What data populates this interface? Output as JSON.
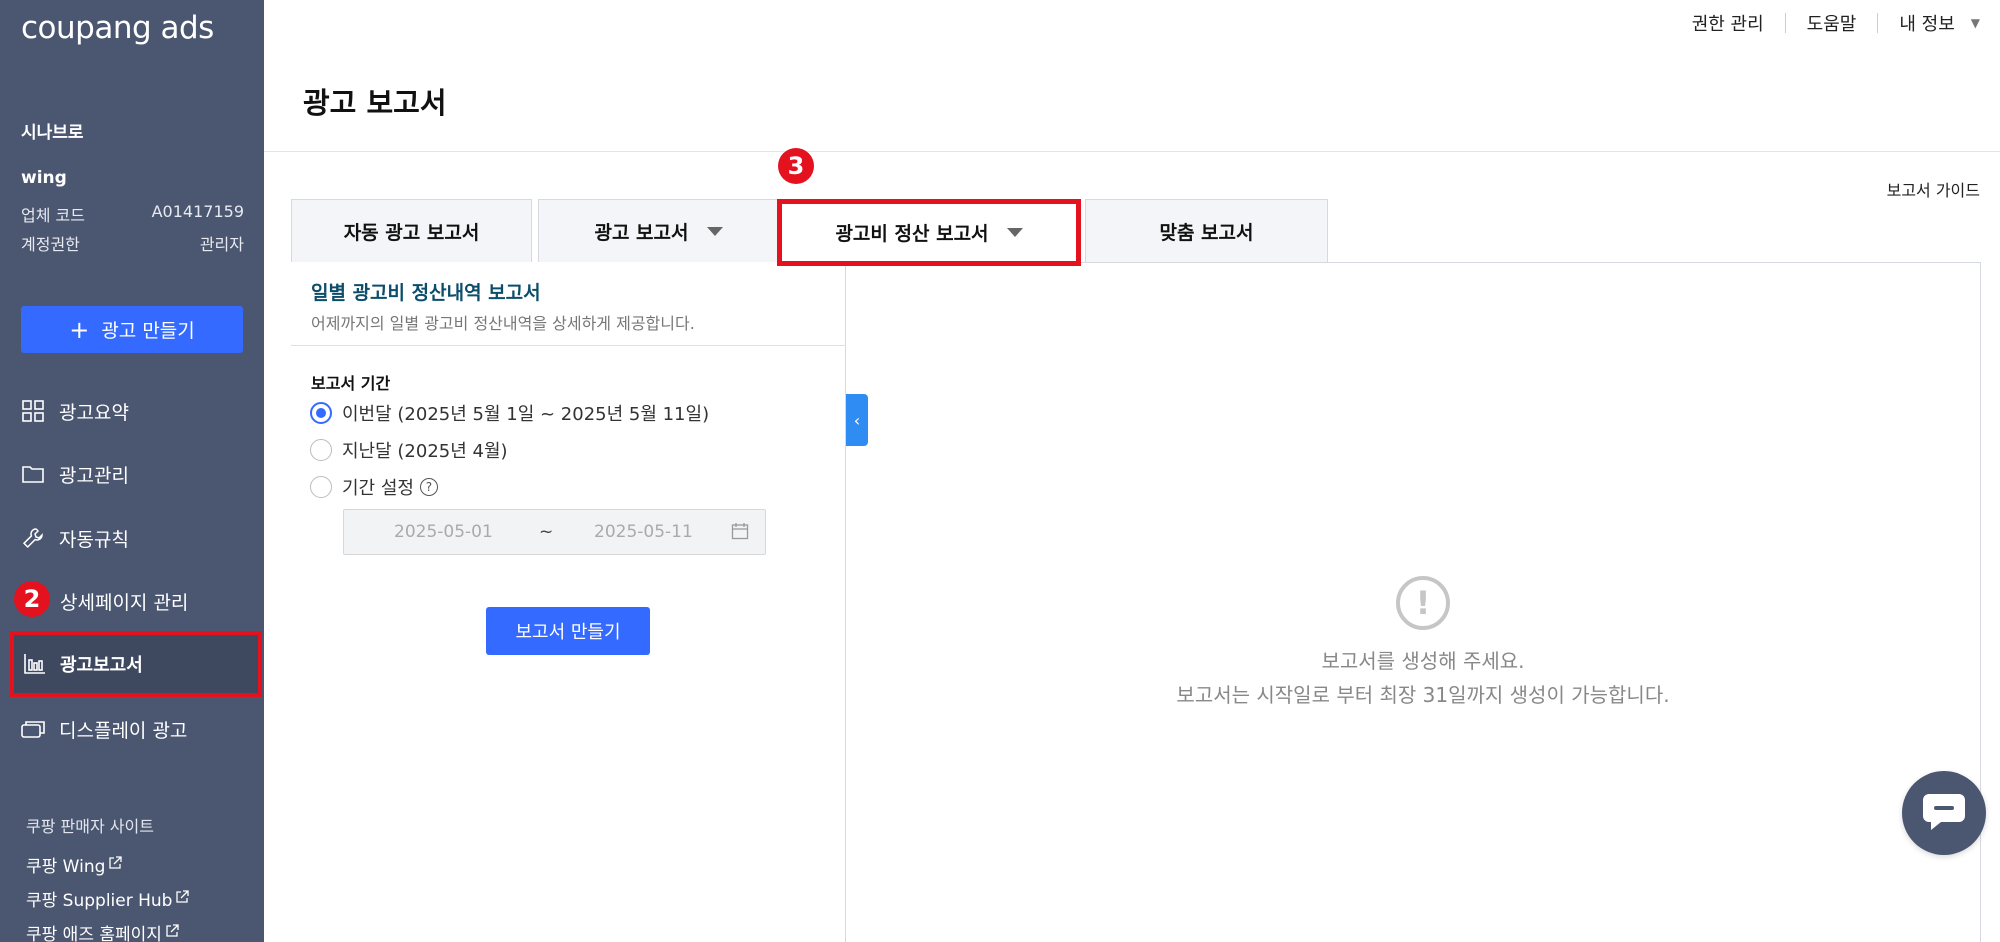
{
  "sidebar": {
    "logo": "coupang ads",
    "company_name": "시나브로",
    "account_id": "wing",
    "vendor_code_label": "업체 코드",
    "vendor_code_value": "A01417159",
    "permission_label": "계정권한",
    "permission_value": "관리자",
    "create_ad_label": "광고 만들기",
    "nav": {
      "summary": "광고요약",
      "management": "광고관리",
      "auto_rules": "자동규칙",
      "detail_page": "상세페이지 관리",
      "reports": "광고보고서",
      "display": "디스플레이 광고"
    },
    "seller_sites_title": "쿠팡 판매자 사이트",
    "seller_links": [
      "쿠팡 Wing",
      "쿠팡 Supplier Hub",
      "쿠팡 애즈 홈페이지"
    ]
  },
  "annotations": {
    "badge_2": "2",
    "badge_3": "3"
  },
  "header": {
    "permission_mgmt": "권한 관리",
    "help": "도움말",
    "my_info": "내 정보"
  },
  "page": {
    "title": "광고 보고서",
    "guide_link": "보고서 가이드"
  },
  "tabs": [
    {
      "label": "자동 광고 보고서"
    },
    {
      "label": "광고 보고서"
    },
    {
      "label": "광고비 정산 보고서"
    },
    {
      "label": "맞춤 보고서"
    }
  ],
  "left_panel": {
    "title": "일별 광고비 정산내역 보고서",
    "description": "어제까지의 일별 광고비 정산내역을 상세하게 제공합니다.",
    "period_label": "보고서 기간",
    "options": [
      {
        "label": "이번달 (2025년 5월 1일 ~ 2025년 5월 11일)",
        "selected": true
      },
      {
        "label": "지난달 (2025년 4월)",
        "selected": false
      },
      {
        "label": "기간 설정",
        "selected": false
      }
    ],
    "date_start": "2025-05-01",
    "date_sep": "~",
    "date_end": "2025-05-11",
    "make_report_button": "보고서 만들기"
  },
  "right_panel": {
    "empty_line1": "보고서를 생성해 주세요.",
    "empty_line2": "보고서는 시작일로 부터 최장 31일까지 생성이 가능합니다."
  },
  "colors": {
    "sidebar_bg": "#4b5670",
    "primary": "#346aff",
    "highlight": "#e4121e",
    "panel_title": "#0b4d6a"
  }
}
